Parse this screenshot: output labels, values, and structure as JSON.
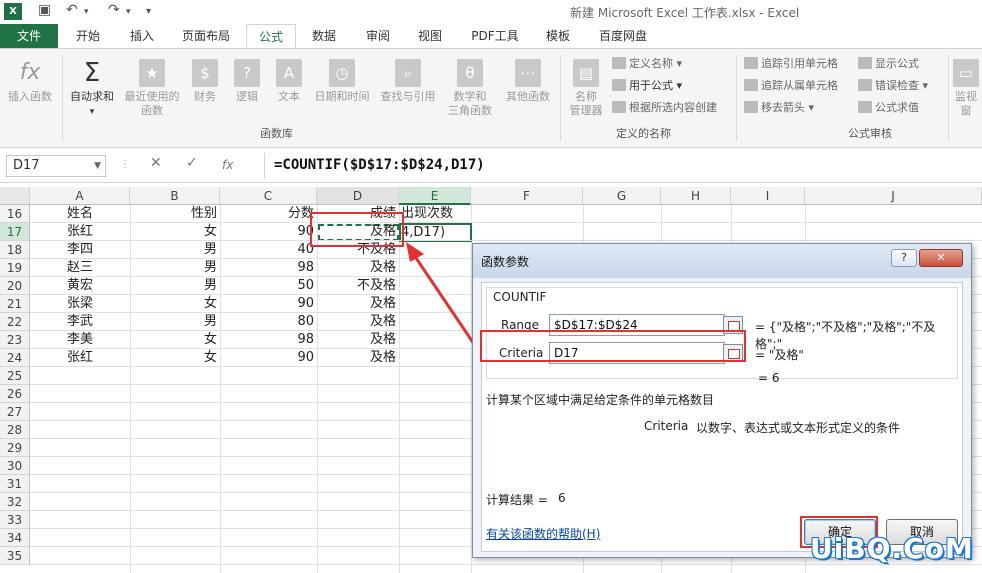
{
  "window": {
    "logo": "X",
    "title": "新建 Microsoft Excel 工作表.xlsx - Excel"
  },
  "tabs": [
    "文件",
    "开始",
    "插入",
    "页面布局",
    "公式",
    "数据",
    "审阅",
    "视图",
    "PDF工具",
    "模板",
    "百度网盘"
  ],
  "active_tab": "公式",
  "ribbon": {
    "insert_function": "插入函数",
    "autosum": "自动求和",
    "recent": "最近使用的",
    "recent2": "函数",
    "financial": "财务",
    "logical": "逻辑",
    "text": "文本",
    "datetime": "日期和时间",
    "lookup": "查找与引用",
    "math": "数学和",
    "math2": "三角函数",
    "more": "其他函数",
    "group_library": "函数库",
    "name_manager": "名称",
    "name_manager2": "管理器",
    "define_name": "定义名称",
    "use_in_formula": "用于公式",
    "create_from_sel": "根据所选内容创建",
    "group_names": "定义的名称",
    "trace_precedents": "追踪引用单元格",
    "trace_dependents": "追踪从属单元格",
    "remove_arrows": "移去箭头",
    "show_formulas": "显示公式",
    "error_check": "错误检查",
    "evaluate": "公式求值",
    "group_audit": "公式审核",
    "watch": "监视窗"
  },
  "formula_bar": {
    "name_box": "D17",
    "cancel": "✕",
    "enter": "✓",
    "fx": "fx",
    "formula": "=COUNTIF($D$17:$D$24,D17)"
  },
  "columns": [
    "A",
    "B",
    "C",
    "D",
    "E",
    "F",
    "G",
    "H",
    "I",
    "J"
  ],
  "rows": [
    "16",
    "17",
    "18",
    "19",
    "20",
    "21",
    "22",
    "23",
    "24",
    "25",
    "26",
    "27",
    "28",
    "29",
    "30",
    "31",
    "32",
    "33",
    "34",
    "35"
  ],
  "table": {
    "header": [
      "姓名",
      "性别",
      "分数",
      "成绩",
      "出现次数"
    ],
    "data": [
      [
        "张红",
        "女",
        "90",
        "及格"
      ],
      [
        "李四",
        "男",
        "40",
        "不及格"
      ],
      [
        "赵三",
        "男",
        "98",
        "及格"
      ],
      [
        "黄宏",
        "男",
        "50",
        "不及格"
      ],
      [
        "张梁",
        "女",
        "90",
        "及格"
      ],
      [
        "李武",
        "男",
        "80",
        "及格"
      ],
      [
        "李美",
        "女",
        "98",
        "及格"
      ],
      [
        "张红",
        "女",
        "90",
        "及格"
      ]
    ],
    "editing_cell": "4,D17)"
  },
  "dialog": {
    "title": "函数参数",
    "help_btn": "?",
    "close_btn": "✕",
    "function_name": "COUNTIF",
    "range_label": "Range",
    "range_value": "$D$17:$D$24",
    "range_result": "= {\"及格\";\"不及格\";\"及格\";\"不及格\";\"",
    "criteria_label": "Criteria",
    "criteria_value": "D17",
    "criteria_result": "= \"及格\"",
    "overall_result": "= 6",
    "description": "计算某个区域中满足给定条件的单元格数目",
    "arg_name": "Criteria",
    "arg_desc": "以数字、表达式或文本形式定义的条件",
    "calc_result_label": "计算结果 =",
    "calc_result_value": "6",
    "help_link": "有关该函数的帮助(H)",
    "ok": "确定",
    "cancel": "取消"
  },
  "watermark": "UiBQ.CoM"
}
